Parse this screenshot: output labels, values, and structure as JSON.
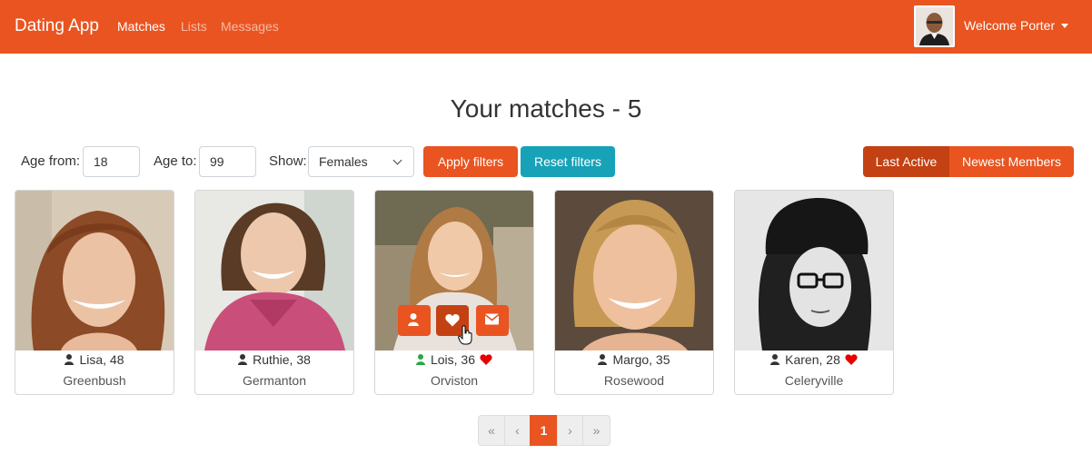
{
  "nav": {
    "brand": "Dating App",
    "links": [
      "Matches",
      "Lists",
      "Messages"
    ],
    "welcome": "Welcome Porter"
  },
  "page": {
    "title": "Your matches - 5"
  },
  "filters": {
    "age_from_label": "Age from:",
    "age_from_value": "18",
    "age_to_label": "Age to:",
    "age_to_value": "99",
    "show_label": "Show:",
    "show_value": "Females",
    "apply_label": "Apply filters",
    "reset_label": "Reset filters",
    "sort_last_active": "Last Active",
    "sort_newest": "Newest Members"
  },
  "members": [
    {
      "name_age": "Lisa, 48",
      "city": "Greenbush",
      "online": false,
      "liked": false
    },
    {
      "name_age": "Ruthie, 38",
      "city": "Germanton",
      "online": false,
      "liked": false
    },
    {
      "name_age": "Lois, 36",
      "city": "Orviston",
      "online": true,
      "liked": true
    },
    {
      "name_age": "Margo, 35",
      "city": "Rosewood",
      "online": false,
      "liked": false
    },
    {
      "name_age": "Karen, 28",
      "city": "Celeryville",
      "online": false,
      "liked": true
    }
  ],
  "pagination": {
    "first": "«",
    "prev": "‹",
    "current": "1",
    "next": "›",
    "last": "»"
  },
  "colors": {
    "primary": "#e95420",
    "active_sort": "#c34113",
    "teal": "#17a2b8",
    "online": "#28a745",
    "heart": "#e60000"
  },
  "icons": {
    "person": "user-icon",
    "like": "heart-icon",
    "message": "envelope-icon"
  }
}
